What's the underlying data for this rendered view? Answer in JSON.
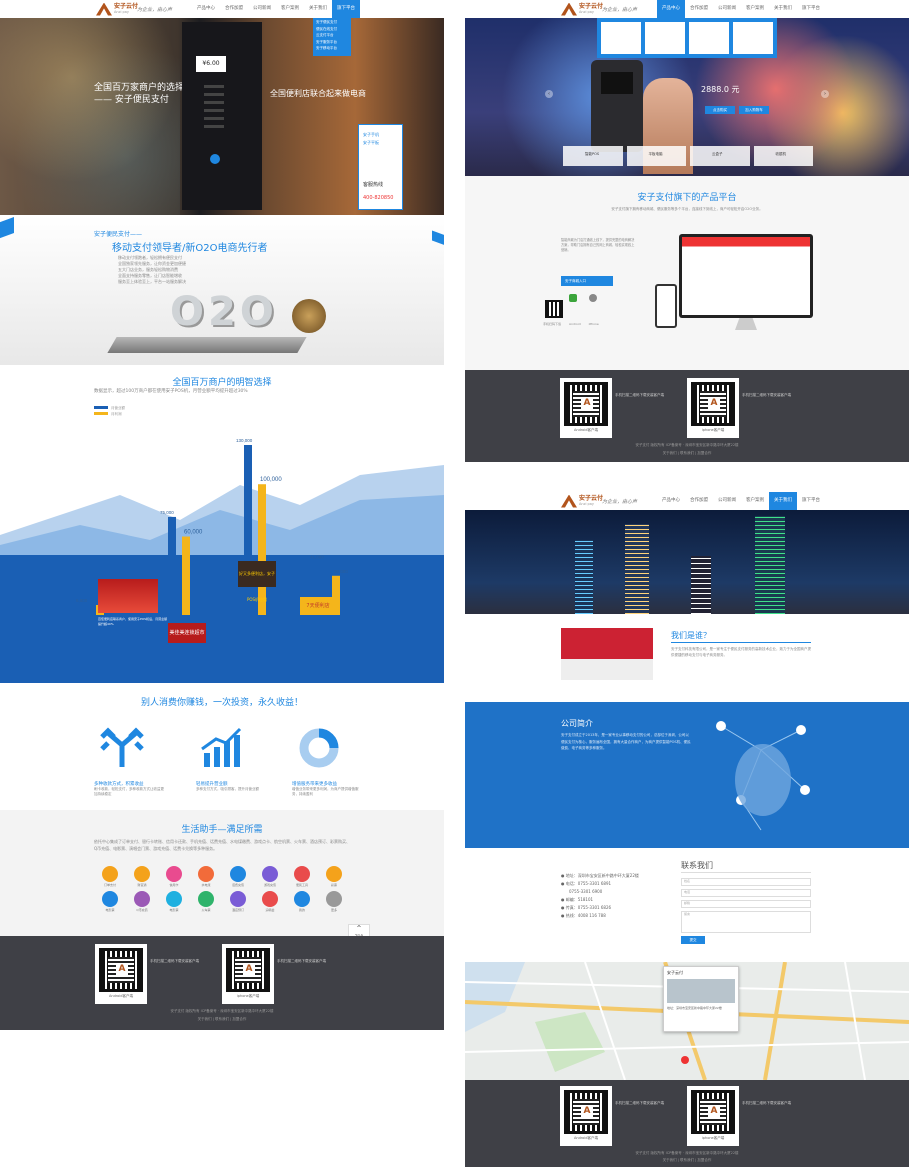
{
  "header": {
    "logo": "安子云付",
    "logo_sub": "Anzi pay",
    "slogan": "为企业，由心声",
    "nav": [
      "产品中心",
      "合作加盟",
      "公司新闻",
      "客户案例",
      "关于我们",
      "旗下平台"
    ]
  },
  "pageA": {
    "hero_line1": "全国百万家商户的选择",
    "hero_line2": "—— 安子便民支付",
    "hero_center": "全国便利店联合起来做电商",
    "pos_amount": "¥6.00",
    "dropdown": [
      "安子便民支付",
      "便民在线支付",
      "云支付平台",
      "安子服务平台",
      "安子移动平台"
    ],
    "hotline_label": "客服热线",
    "hotline": "400-820850",
    "chip1": "安子手机",
    "chip2": "安子平板",
    "intro_kicker": "安子便民支付——",
    "intro_title": "移动支付领导者/新O2O电商先行者",
    "intro_points": [
      "移动支付领跑者，轻松拥有便民支付",
      "全国独家领先服务，让你资金更加便捷",
      "五大门店业务，服务轻松购物消费",
      "全面支持服务零售，让门店智能增收",
      "服务至上体验至上，平台一站服务解决"
    ],
    "o2o": "O2O",
    "growth_title": "全国百万商户的明智选择",
    "growth_sub": "数据显示，超过100万商户都在使用安子POS机，月营业额平均提升超过30%",
    "legend": [
      "月营业额",
      "月利润"
    ],
    "bar_labels": [
      "6,500",
      "3,000",
      "75,000",
      "60,000",
      "130,000",
      "100,000",
      "41,000",
      "30,000"
    ],
    "case_cap1": "百佳便利店联系商户，使用安子POS机后，月营业额提升超40%",
    "case_cap2": "美佳美连锁超市",
    "case_cap3": "好又多便利店，安子POS机应用",
    "case_cap4": "7天便利店",
    "earn_title": "别人消费你赚钱，一次投资，永久收益！",
    "earn_items": [
      {
        "title": "多种收款方式，积累收益",
        "desc": "刷卡收款，轻松支付，多种收款方式让收益更加持续稳定"
      },
      {
        "title": "轻易提升营业额",
        "desc": "多种支付方式，吸引顾客，提升月营业额"
      },
      {
        "title": "增值服务带来更多收益",
        "desc": "增值业务带来更多利润，为商户提供增值服务，持续盈利"
      }
    ],
    "life_title": "生活助手—满足所需",
    "life_desc": "依托中心集成了订单支付、银行卡转账、信用卡还款、手机充值、话费充值、水电煤缴费、游戏点卡、航空机票、火车票、酒店预订、彩票购买、Q币充值、电影票、演唱会门票、游戏充值、话费卡兑换等多种服务。",
    "life_icons": [
      "订单支付",
      "财富通",
      "信用卡",
      "水电煤",
      "话费充值",
      "游戏充值",
      "便民工具",
      "彩票",
      "电影票",
      "Q币充值",
      "电影票",
      "火车票",
      "酒店预订",
      "演唱会",
      "我的",
      "更多"
    ],
    "top": "TOP"
  },
  "pageB": {
    "price": "2888.0 元",
    "btn1": "点击购买",
    "btn2": "加入购物车",
    "tabs": [
      "智能POS",
      "平板电脑",
      "云盒子",
      "收银机"
    ],
    "platform_title": "安子支付旗下的产品平台",
    "platform_desc": "安子支付旗下拥有移动商城、便民服务等多个平台，连接线下到线上，商户可轻松开启O2O业务。",
    "mall_desc": "智能商城为门店打通线上线下，提供完整的电商解决方案，帮助门店拥有自己的网上商城，轻松实现线上营销。",
    "mall_btn": "安子商城入口",
    "apps": [
      "手机扫码下载",
      "Android",
      "iPhone"
    ]
  },
  "pageC": {
    "banner": "",
    "about_title": "我们是谁？",
    "about_desc": "安子支付科技有限公司，是一家专注于便民支付服务的高新技术企业，致力于为全国商户提供便捷的移动支付与电子商务服务。",
    "company_title": "公司简介",
    "company_desc": "安子支付成立于2013年，是一家专业从事移动支付的公司，总部位于深圳，公司以便民支付为核心，服务遍布全国，拥有大量合作商户，为商户提供智能POS机、便民缴费、电子商务等多种服务。",
    "contact_title": "联系我们",
    "contact": [
      "地址：深圳市宝安区新中路中环大厦22楼",
      "电话：0755-3301 6891",
      "0755-3301 6900",
      "邮编：518101",
      "传真：0755-3301 6826",
      "热线：4008 116 788"
    ],
    "fields": [
      "姓名",
      "电话",
      "邮箱",
      "留言"
    ],
    "submit": "提交"
  },
  "footer": {
    "qr1_cap": "Android客户端",
    "qr2_cap": "iphone客户端",
    "qr1_txt": "手机扫描二维码下载安装客户端",
    "qr2_txt": "手机扫描二维码下载安装客户端",
    "copyright": "安子支付 版权所有 ICP备案号 · 深圳市宝安区新中路中环大厦22楼",
    "links": "关于我们 | 联系我们 | 加盟合作"
  },
  "colors": {
    "brand_blue": "#1f87e0",
    "brand_orange": "#b2541c",
    "footer": "#3f4046",
    "bar_blue": "#1a5fb4",
    "bar_yellow": "#f4b51b"
  }
}
